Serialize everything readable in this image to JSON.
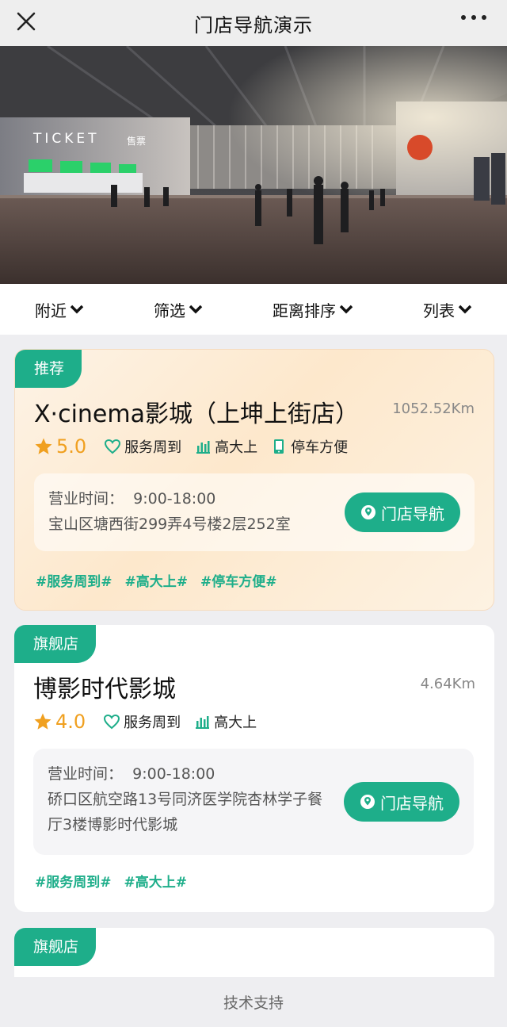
{
  "header": {
    "title": "门店导航演示"
  },
  "filters": [
    {
      "label": "附近"
    },
    {
      "label": "筛选"
    },
    {
      "label": "距离排序"
    },
    {
      "label": "列表"
    }
  ],
  "banner": {
    "sign_text": "TICKET",
    "sign_text_cn": "售票"
  },
  "stores": [
    {
      "badge": "推荐",
      "name": "X·cinema影城（上坤上街店）",
      "distance": "1052.52Km",
      "rating": "5.0",
      "features": [
        "服务周到",
        "高大上",
        "停车方便"
      ],
      "hours_label": "营业时间：",
      "hours": "9:00-18:00",
      "address": "宝山区塘西街299弄4号楼2层252室",
      "nav_label": "门店导航",
      "tags": [
        "#服务周到#",
        "#高大上#",
        "#停车方便#"
      ]
    },
    {
      "badge": "旗舰店",
      "name": "博影时代影城",
      "distance": "4.64Km",
      "rating": "4.0",
      "features": [
        "服务周到",
        "高大上"
      ],
      "hours_label": "营业时间：",
      "hours": "9:00-18:00",
      "address": "硚口区航空路13号同济医学院杏林学子餐厅3楼博影时代影城",
      "nav_label": "门店导航",
      "tags": [
        "#服务周到#",
        "#高大上#"
      ]
    },
    {
      "badge": "旗舰店"
    }
  ],
  "footer": {
    "label": "技术支持"
  },
  "colors": {
    "accent": "#1eae8a",
    "star": "#f0a020"
  }
}
